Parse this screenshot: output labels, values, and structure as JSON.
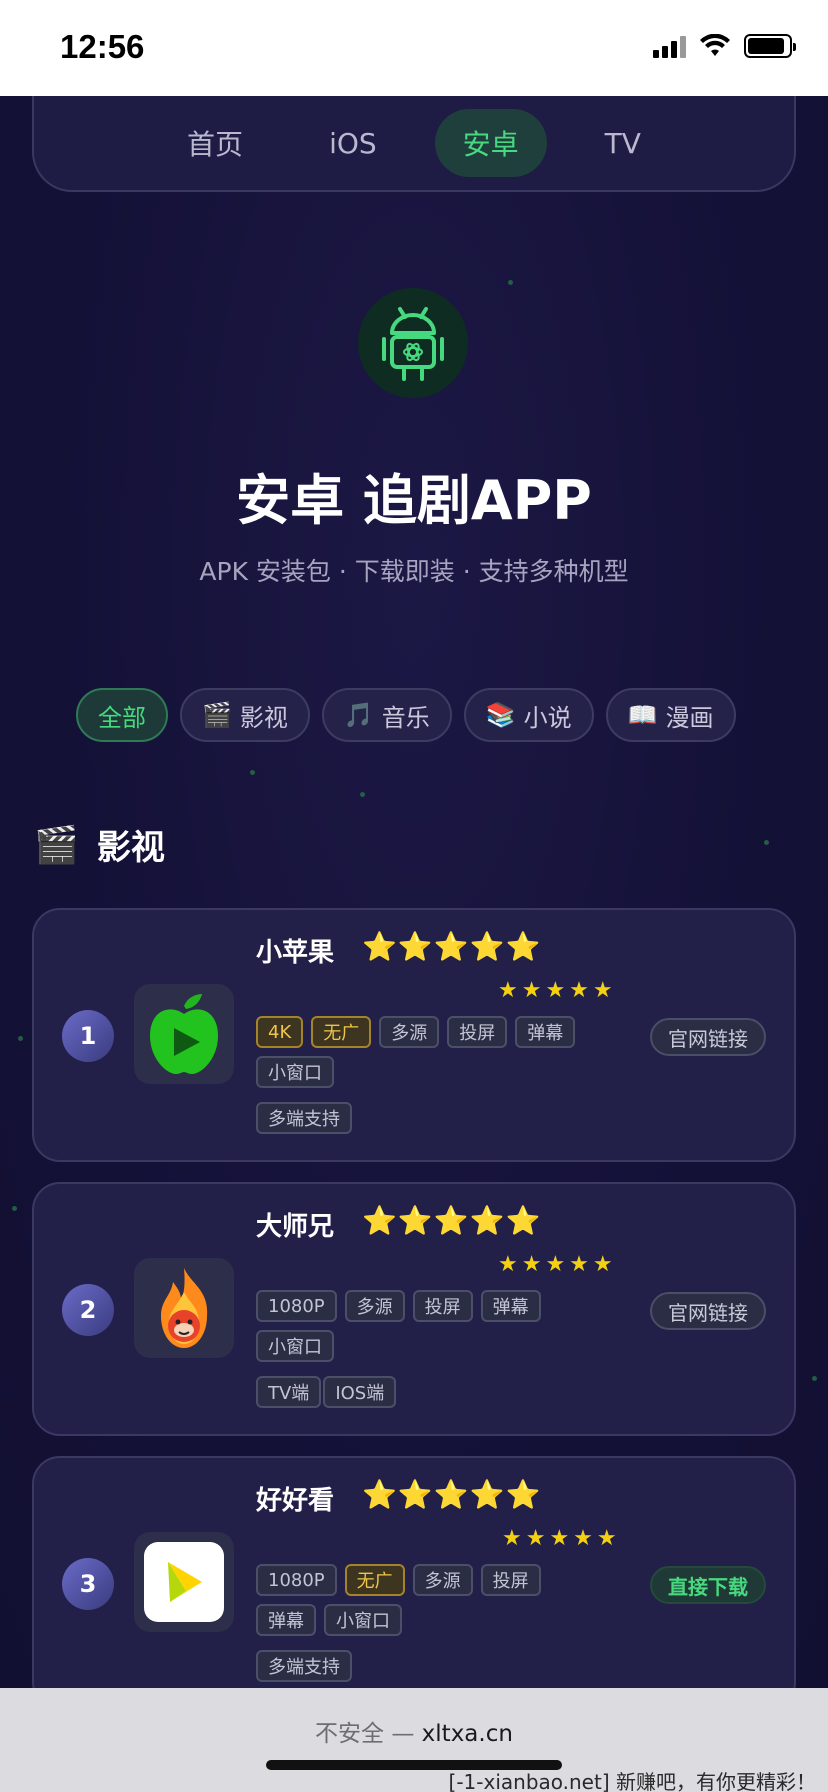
{
  "status": {
    "time": "12:56"
  },
  "nav": {
    "tabs": [
      "首页",
      "iOS",
      "安卓",
      "TV"
    ],
    "active": "安卓"
  },
  "hero": {
    "icon": "android-icon",
    "title": "安卓 追剧APP",
    "subtitle": "APK 安装包 · 下载即装 · 支持多种机型"
  },
  "filters": [
    {
      "emoji": "",
      "label": "全部",
      "active": true
    },
    {
      "emoji": "🎬",
      "label": "影视"
    },
    {
      "emoji": "🎵",
      "label": "音乐"
    },
    {
      "emoji": "📚",
      "label": "小说"
    },
    {
      "emoji": "📖",
      "label": "漫画"
    }
  ],
  "section": {
    "emoji": "🎬",
    "title": "影视"
  },
  "apps": [
    {
      "rank": "1",
      "name": "小苹果",
      "stars_big": "⭐⭐⭐⭐⭐",
      "stars_small": "★★★★★",
      "tags": [
        {
          "text": "4K",
          "gold": true
        },
        {
          "text": "无广",
          "gold": true
        },
        {
          "text": "多源"
        },
        {
          "text": "投屏"
        },
        {
          "text": "弹幕"
        },
        {
          "text": "小窗口"
        }
      ],
      "tags2": [
        "多端支持"
      ],
      "action": "官网链接",
      "action_green": false,
      "icon": "green-apple-play-icon"
    },
    {
      "rank": "2",
      "name": "大师兄",
      "stars_big": "⭐⭐⭐⭐⭐",
      "stars_small": "★★★★★",
      "tags": [
        {
          "text": "1080P"
        },
        {
          "text": "多源"
        },
        {
          "text": "投屏"
        },
        {
          "text": "弹幕"
        },
        {
          "text": "小窗口"
        }
      ],
      "tags2": [
        "TV端",
        "IOS端"
      ],
      "action": "官网链接",
      "action_green": false,
      "icon": "fire-monkey-icon"
    },
    {
      "rank": "3",
      "name": "好好看",
      "stars_big": "⭐⭐⭐⭐⭐",
      "stars_small": "★★★★★",
      "tags": [
        {
          "text": "1080P"
        },
        {
          "text": "无广",
          "gold": true
        },
        {
          "text": "多源"
        },
        {
          "text": "投屏"
        },
        {
          "text": "弹幕"
        },
        {
          "text": "小窗口"
        }
      ],
      "tags2": [
        "多端支持"
      ],
      "action": "直接下载",
      "action_green": true,
      "icon": "yellow-play-icon"
    }
  ],
  "browser": {
    "insecure": "不安全 —",
    "domain": "xltxa.cn",
    "note": "[-1-xianbao.net] 新赚吧，有你更精彩！"
  }
}
